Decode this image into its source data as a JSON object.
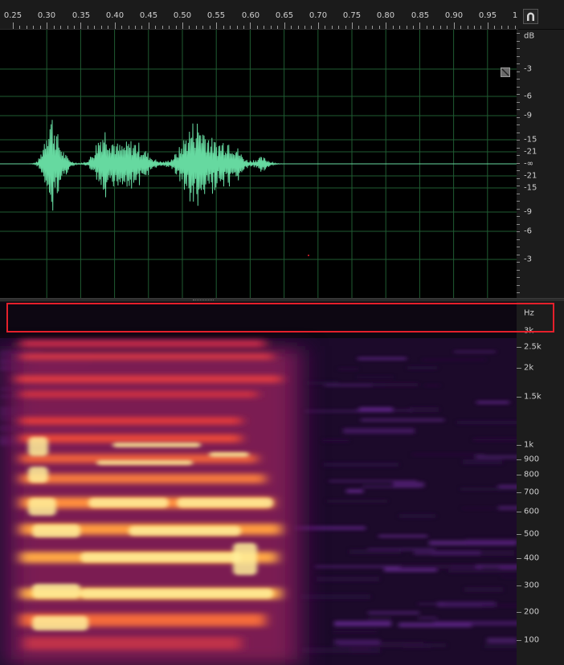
{
  "time_ruler": {
    "labels": [
      "0.25",
      "0.30",
      "0.35",
      "0.40",
      "0.45",
      "0.50",
      "0.55",
      "0.60",
      "0.65",
      "0.70",
      "0.75",
      "0.80",
      "0.85",
      "0.90",
      "0.95",
      "1"
    ]
  },
  "db_ruler": {
    "unit": "dB",
    "labels": [
      "-3",
      "-6",
      "-9",
      "-15",
      "-21",
      "-∞",
      "-21",
      "-15",
      "-9",
      "-6",
      "-3"
    ]
  },
  "hz_ruler": {
    "unit": "Hz",
    "labels": [
      "3k",
      "2.5k",
      "2k",
      "1.5k",
      "1k",
      "900",
      "800",
      "700",
      "600",
      "500",
      "400",
      "300",
      "200",
      "100"
    ]
  },
  "icons": {
    "snap": "magnet-icon",
    "fit": "zoom-fit-icon"
  },
  "colors": {
    "waveform": "#66d9a0",
    "grid": "#1f5c32",
    "highlight": "#e5202b",
    "spectral_hot": "#fff3a0",
    "spectral_mid": "#e7303c",
    "spectral_low": "#3a0d52"
  }
}
